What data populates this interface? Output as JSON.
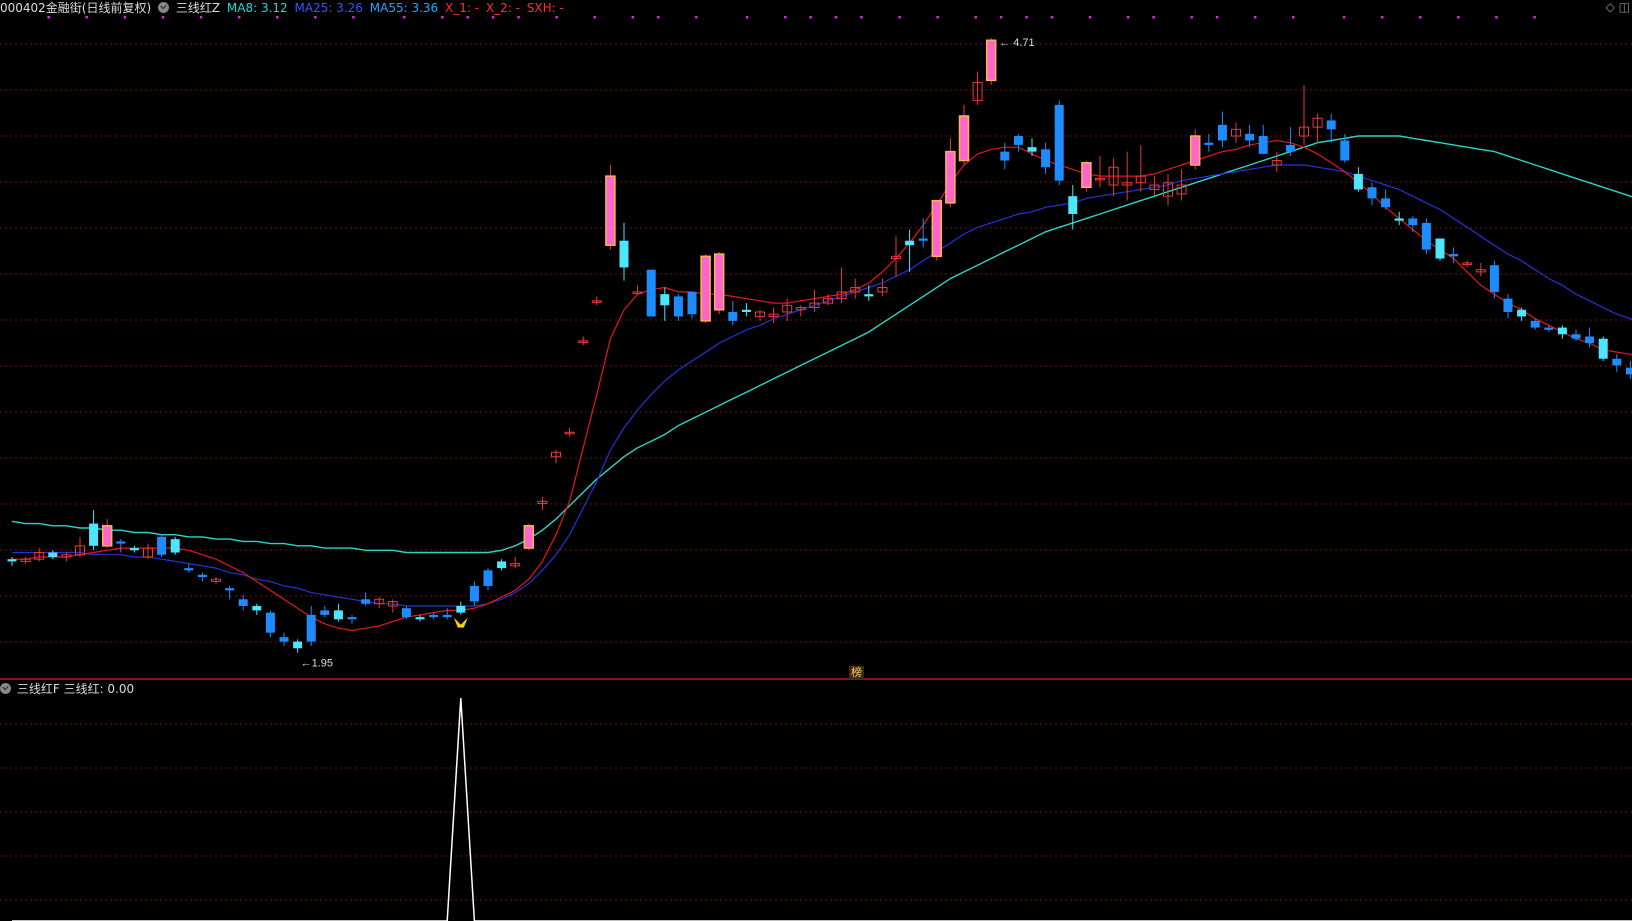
{
  "header": {
    "stock_title": "000402金融街(日线前复权)",
    "indicator_name": "三线红Z",
    "ma8": "MA8: 3.12",
    "ma25": "MA25: 3.26",
    "ma55": "MA55: 3.36",
    "x1": "X_1: -",
    "x2": "X_2: -",
    "sxh": "SXH: -"
  },
  "sub_header": {
    "indicator_name": "三线红F",
    "value": "三线红: 0.00"
  },
  "annotations": {
    "high_label": "4.71",
    "low_label": "1.95",
    "badge": "榜"
  },
  "colors": {
    "background": "#000000",
    "grid": "#7a1010",
    "divider": "#c01818",
    "up_candle": "#ff66cc",
    "up_candle_body_alt": "#ffb34d",
    "up_wick": "#e83a3a",
    "down_candle": "#4de6ff",
    "down_candle_alt": "#1e8cff",
    "ma8": "#29d6c6",
    "ma25": "#2433d6",
    "ma55": "#e01a1a",
    "signal_line": "#ffffff",
    "marker": "#cc33cc",
    "arrow": "#ffcc00",
    "stock_title": "#dddddd",
    "ma8_label": "#20d8d8",
    "ma25_label": "#3355ff",
    "ma55_label": "#20a8ff",
    "x_label": "#ff3030"
  },
  "icons": [
    "check-circle-icon",
    "diamond-icon",
    "window-restore-icon"
  ],
  "chart_data": [
    {
      "type": "candlestick",
      "series": [
        {
          "name": "MA8"
        },
        {
          "name": "MA25"
        },
        {
          "name": "MA55"
        }
      ],
      "ylim": [
        1.85,
        4.8
      ],
      "annotations": [
        "4.71",
        "1.95"
      ],
      "ohlc": [
        [
          2.37,
          2.38,
          2.34,
          2.36
        ],
        [
          2.36,
          2.38,
          2.35,
          2.37
        ],
        [
          2.37,
          2.42,
          2.36,
          2.4
        ],
        [
          2.4,
          2.41,
          2.37,
          2.38
        ],
        [
          2.38,
          2.4,
          2.36,
          2.39
        ],
        [
          2.39,
          2.47,
          2.38,
          2.43
        ],
        [
          2.53,
          2.59,
          2.41,
          2.43
        ],
        [
          2.43,
          2.55,
          2.42,
          2.52
        ],
        [
          2.45,
          2.46,
          2.4,
          2.44
        ],
        [
          2.42,
          2.43,
          2.4,
          2.41
        ],
        [
          2.38,
          2.44,
          2.37,
          2.42
        ],
        [
          2.47,
          2.48,
          2.38,
          2.39
        ],
        [
          2.46,
          2.47,
          2.39,
          2.4
        ],
        [
          2.33,
          2.35,
          2.31,
          2.32
        ],
        [
          2.3,
          2.31,
          2.27,
          2.29
        ],
        [
          2.27,
          2.29,
          2.26,
          2.28
        ],
        [
          2.24,
          2.25,
          2.19,
          2.23
        ],
        [
          2.19,
          2.21,
          2.14,
          2.16
        ],
        [
          2.16,
          2.17,
          2.12,
          2.14
        ],
        [
          2.13,
          2.14,
          2.02,
          2.04
        ],
        [
          2.02,
          2.04,
          1.98,
          2.0
        ],
        [
          2.0,
          2.01,
          1.95,
          1.97
        ],
        [
          2.12,
          2.16,
          1.98,
          2.0
        ],
        [
          2.14,
          2.16,
          2.11,
          2.12
        ],
        [
          2.14,
          2.17,
          2.09,
          2.1
        ],
        [
          2.11,
          2.12,
          2.08,
          2.1
        ],
        [
          2.19,
          2.22,
          2.16,
          2.17
        ],
        [
          2.17,
          2.2,
          2.15,
          2.19
        ],
        [
          2.16,
          2.19,
          2.13,
          2.18
        ],
        [
          2.15,
          2.16,
          2.1,
          2.11
        ],
        [
          2.11,
          2.12,
          2.09,
          2.1
        ],
        [
          2.12,
          2.13,
          2.1,
          2.11
        ],
        [
          2.12,
          2.15,
          2.1,
          2.11
        ],
        [
          2.16,
          2.18,
          2.12,
          2.13
        ],
        [
          2.25,
          2.27,
          2.16,
          2.18
        ],
        [
          2.32,
          2.33,
          2.23,
          2.25
        ],
        [
          2.36,
          2.37,
          2.32,
          2.33
        ],
        [
          2.34,
          2.38,
          2.33,
          2.35
        ],
        [
          2.42,
          2.53,
          2.41,
          2.52
        ],
        [
          2.62,
          2.65,
          2.59,
          2.63
        ],
        [
          2.83,
          2.86,
          2.8,
          2.85
        ],
        [
          2.94,
          2.96,
          2.92,
          2.94
        ],
        [
          3.35,
          3.37,
          3.33,
          3.35
        ],
        [
          3.53,
          3.55,
          3.51,
          3.53
        ],
        [
          3.78,
          4.14,
          3.76,
          4.09
        ],
        [
          3.8,
          3.88,
          3.62,
          3.68
        ],
        [
          3.57,
          3.6,
          3.57,
          3.57
        ],
        [
          3.67,
          3.6,
          3.46,
          3.46
        ],
        [
          3.56,
          3.59,
          3.44,
          3.51
        ],
        [
          3.55,
          3.56,
          3.44,
          3.46
        ],
        [
          3.57,
          3.55,
          3.45,
          3.47
        ],
        [
          3.44,
          3.74,
          3.43,
          3.73
        ],
        [
          3.49,
          3.75,
          3.47,
          3.74
        ],
        [
          3.48,
          3.53,
          3.42,
          3.44
        ],
        [
          3.49,
          3.52,
          3.46,
          3.48
        ],
        [
          3.46,
          3.49,
          3.44,
          3.48
        ],
        [
          3.46,
          3.5,
          3.43,
          3.47
        ],
        [
          3.48,
          3.54,
          3.44,
          3.51
        ],
        [
          3.49,
          3.51,
          3.46,
          3.5
        ],
        [
          3.5,
          3.58,
          3.48,
          3.52
        ],
        [
          3.52,
          3.56,
          3.51,
          3.54
        ],
        [
          3.54,
          3.68,
          3.52,
          3.57
        ],
        [
          3.57,
          3.63,
          3.54,
          3.59
        ],
        [
          3.56,
          3.6,
          3.53,
          3.55
        ],
        [
          3.57,
          3.63,
          3.55,
          3.59
        ],
        [
          3.72,
          3.82,
          3.64,
          3.73
        ],
        [
          3.8,
          3.85,
          3.66,
          3.78
        ],
        [
          3.81,
          3.9,
          3.77,
          3.8
        ],
        [
          3.73,
          3.98,
          3.71,
          3.98
        ],
        [
          3.97,
          4.26,
          3.95,
          4.2
        ],
        [
          4.16,
          4.41,
          4.14,
          4.36
        ],
        [
          4.43,
          4.56,
          4.41,
          4.51
        ],
        [
          4.52,
          4.71,
          4.5,
          4.7
        ],
        [
          4.2,
          4.24,
          4.12,
          4.16
        ],
        [
          4.27,
          4.28,
          4.2,
          4.23
        ],
        [
          4.22,
          4.26,
          4.18,
          4.2
        ],
        [
          4.21,
          4.24,
          4.1,
          4.13
        ],
        [
          4.41,
          4.43,
          4.05,
          4.07
        ],
        [
          4.0,
          4.05,
          3.85,
          3.92
        ],
        [
          4.04,
          4.16,
          4.02,
          4.15
        ],
        [
          4.08,
          4.18,
          4.04,
          4.08
        ],
        [
          4.05,
          4.17,
          4.0,
          4.13
        ],
        [
          4.05,
          4.2,
          3.98,
          4.06
        ],
        [
          4.06,
          4.23,
          4.02,
          4.09
        ],
        [
          4.03,
          4.09,
          4.0,
          4.05
        ],
        [
          4.0,
          4.1,
          3.96,
          4.06
        ],
        [
          4.01,
          4.12,
          3.98,
          4.05
        ],
        [
          4.14,
          4.3,
          4.12,
          4.27
        ],
        [
          4.24,
          4.28,
          4.2,
          4.23
        ],
        [
          4.32,
          4.38,
          4.22,
          4.25
        ],
        [
          4.27,
          4.33,
          4.24,
          4.3
        ],
        [
          4.28,
          4.32,
          4.22,
          4.25
        ],
        [
          4.27,
          4.32,
          4.19,
          4.19
        ],
        [
          4.14,
          4.2,
          4.11,
          4.16
        ],
        [
          4.23,
          4.31,
          4.18,
          4.2
        ],
        [
          4.27,
          4.5,
          4.23,
          4.31
        ],
        [
          4.31,
          4.37,
          4.24,
          4.35
        ],
        [
          4.34,
          4.37,
          4.24,
          4.3
        ],
        [
          4.25,
          4.28,
          4.15,
          4.16
        ],
        [
          4.1,
          4.13,
          4.02,
          4.03
        ],
        [
          4.04,
          4.06,
          3.96,
          3.99
        ],
        [
          3.99,
          4.03,
          3.94,
          3.95
        ],
        [
          3.9,
          3.93,
          3.87,
          3.89
        ],
        [
          3.9,
          3.91,
          3.84,
          3.87
        ],
        [
          3.88,
          3.9,
          3.74,
          3.76
        ],
        [
          3.81,
          3.81,
          3.71,
          3.72
        ],
        [
          3.74,
          3.77,
          3.7,
          3.73
        ],
        [
          3.7,
          3.71,
          3.68,
          3.7
        ],
        [
          3.66,
          3.7,
          3.64,
          3.67
        ],
        [
          3.69,
          3.71,
          3.54,
          3.57
        ],
        [
          3.54,
          3.56,
          3.45,
          3.48
        ],
        [
          3.49,
          3.5,
          3.44,
          3.46
        ],
        [
          3.44,
          3.45,
          3.4,
          3.41
        ],
        [
          3.41,
          3.42,
          3.39,
          3.4
        ],
        [
          3.41,
          3.42,
          3.36,
          3.38
        ],
        [
          3.38,
          3.4,
          3.35,
          3.36
        ],
        [
          3.37,
          3.41,
          3.32,
          3.34
        ],
        [
          3.36,
          3.37,
          3.26,
          3.27
        ],
        [
          3.27,
          3.29,
          3.21,
          3.24
        ],
        [
          3.23,
          3.26,
          3.18,
          3.2
        ],
        [
          3.31,
          3.35,
          3.22,
          3.25
        ],
        [
          3.3,
          3.33,
          3.25,
          3.28
        ],
        [
          3.32,
          3.35,
          3.28,
          3.3
        ],
        [
          3.35,
          3.38,
          3.3,
          3.33
        ],
        [
          3.34,
          3.36,
          3.28,
          3.33
        ],
        [
          3.33,
          3.35,
          3.3,
          3.31
        ],
        [
          3.32,
          3.34,
          3.3,
          3.32
        ],
        [
          3.27,
          3.29,
          3.22,
          3.24
        ],
        [
          3.22,
          3.24,
          3.2,
          3.21
        ]
      ],
      "ma8": [
        2.37,
        2.37,
        2.38,
        2.38,
        2.38,
        2.39,
        2.4,
        2.41,
        2.42,
        2.42,
        2.42,
        2.42,
        2.42,
        2.41,
        2.39,
        2.37,
        2.34,
        2.31,
        2.27,
        2.23,
        2.19,
        2.15,
        2.11,
        2.08,
        2.06,
        2.05,
        2.06,
        2.07,
        2.09,
        2.11,
        2.12,
        2.13,
        2.14,
        2.14,
        2.15,
        2.17,
        2.2,
        2.23,
        2.28,
        2.36,
        2.48,
        2.63,
        2.87,
        3.11,
        3.36,
        3.49,
        3.56,
        3.58,
        3.59,
        3.57,
        3.57,
        3.56,
        3.56,
        3.55,
        3.54,
        3.53,
        3.52,
        3.52,
        3.53,
        3.54,
        3.55,
        3.56,
        3.58,
        3.61,
        3.66,
        3.72,
        3.79,
        3.87,
        3.96,
        4.06,
        4.14,
        4.19,
        4.21,
        4.22,
        4.22,
        4.19,
        4.16,
        4.14,
        4.12,
        4.1,
        4.09,
        4.09,
        4.09,
        4.09,
        4.1,
        4.12,
        4.14,
        4.16,
        4.18,
        4.2,
        4.21,
        4.23,
        4.24,
        4.25,
        4.24,
        4.22,
        4.19,
        4.15,
        4.11,
        4.06,
        4.01,
        3.95,
        3.9,
        3.85,
        3.8,
        3.76,
        3.72,
        3.66,
        3.6,
        3.56,
        3.52,
        3.49,
        3.45,
        3.42,
        3.39,
        3.36,
        3.34,
        3.31,
        3.3,
        3.29,
        3.29,
        3.29,
        3.29,
        3.29,
        3.28,
        3.28,
        3.27
      ],
      "ma25": [
        2.4,
        2.4,
        2.4,
        2.4,
        2.4,
        2.4,
        2.39,
        2.39,
        2.39,
        2.38,
        2.38,
        2.37,
        2.36,
        2.35,
        2.34,
        2.33,
        2.31,
        2.3,
        2.28,
        2.27,
        2.25,
        2.24,
        2.22,
        2.21,
        2.2,
        2.19,
        2.18,
        2.17,
        2.17,
        2.16,
        2.16,
        2.16,
        2.16,
        2.16,
        2.16,
        2.17,
        2.19,
        2.22,
        2.26,
        2.32,
        2.39,
        2.48,
        2.6,
        2.72,
        2.86,
        2.96,
        3.04,
        3.11,
        3.17,
        3.22,
        3.26,
        3.3,
        3.34,
        3.37,
        3.4,
        3.42,
        3.45,
        3.47,
        3.49,
        3.51,
        3.53,
        3.55,
        3.57,
        3.59,
        3.61,
        3.64,
        3.67,
        3.71,
        3.75,
        3.79,
        3.83,
        3.86,
        3.88,
        3.9,
        3.92,
        3.93,
        3.95,
        3.96,
        3.97,
        3.99,
        4.0,
        4.01,
        4.02,
        4.03,
        4.04,
        4.05,
        4.07,
        4.08,
        4.09,
        4.1,
        4.11,
        4.12,
        4.13,
        4.14,
        4.14,
        4.14,
        4.13,
        4.12,
        4.11,
        4.09,
        4.07,
        4.05,
        4.03,
        4.0,
        3.97,
        3.94,
        3.9,
        3.86,
        3.82,
        3.78,
        3.74,
        3.71,
        3.67,
        3.63,
        3.6,
        3.56,
        3.53,
        3.5,
        3.47,
        3.45,
        3.43,
        3.41,
        3.39,
        3.37,
        3.35,
        3.33,
        3.31
      ],
      "ma55": [
        2.54,
        2.53,
        2.53,
        2.52,
        2.52,
        2.51,
        2.51,
        2.5,
        2.5,
        2.49,
        2.49,
        2.48,
        2.48,
        2.47,
        2.47,
        2.46,
        2.46,
        2.45,
        2.45,
        2.44,
        2.44,
        2.43,
        2.43,
        2.42,
        2.42,
        2.42,
        2.41,
        2.41,
        2.41,
        2.4,
        2.4,
        2.4,
        2.4,
        2.4,
        2.4,
        2.4,
        2.41,
        2.43,
        2.46,
        2.5,
        2.55,
        2.61,
        2.67,
        2.73,
        2.78,
        2.83,
        2.87,
        2.9,
        2.93,
        2.97,
        3.0,
        3.03,
        3.06,
        3.09,
        3.12,
        3.15,
        3.18,
        3.21,
        3.24,
        3.27,
        3.3,
        3.33,
        3.36,
        3.39,
        3.43,
        3.47,
        3.51,
        3.55,
        3.59,
        3.63,
        3.66,
        3.69,
        3.72,
        3.75,
        3.78,
        3.81,
        3.84,
        3.86,
        3.88,
        3.9,
        3.92,
        3.94,
        3.96,
        3.98,
        4.0,
        4.02,
        4.04,
        4.06,
        4.08,
        4.1,
        4.12,
        4.14,
        4.16,
        4.18,
        4.2,
        4.22,
        4.24,
        4.25,
        4.26,
        4.27,
        4.27,
        4.27,
        4.27,
        4.26,
        4.25,
        4.24,
        4.23,
        4.22,
        4.21,
        4.2,
        4.18,
        4.16,
        4.14,
        4.12,
        4.1,
        4.08,
        4.06,
        4.04,
        4.02,
        4.0,
        3.98,
        3.96,
        3.94,
        3.92,
        3.9,
        3.88,
        3.86
      ]
    },
    {
      "type": "line",
      "series": [
        {
          "name": "三线红"
        }
      ],
      "values_description_free": true,
      "values": [
        0,
        0,
        0,
        0,
        0,
        0,
        0,
        0,
        0,
        0,
        0,
        0,
        0,
        0,
        0,
        0,
        0,
        0,
        0,
        0,
        0,
        0,
        0,
        0,
        0,
        0,
        0,
        0,
        0,
        0,
        0,
        0,
        0,
        1,
        0,
        0,
        0,
        0,
        0,
        0,
        0,
        0,
        0,
        0,
        0,
        0,
        0,
        0,
        0,
        0,
        0,
        0,
        0,
        0,
        0,
        0,
        0,
        0,
        0,
        0,
        0,
        0,
        0,
        0,
        0,
        0,
        0,
        0,
        0,
        0,
        0,
        0,
        0,
        0,
        0,
        0,
        0,
        0,
        0,
        0,
        0,
        0,
        0,
        0,
        0,
        0,
        0,
        0,
        0,
        0,
        0,
        0,
        0,
        0,
        0,
        0,
        0,
        0,
        0,
        0,
        0,
        0,
        0,
        0,
        0,
        0,
        0,
        0,
        0,
        0,
        0,
        0,
        0,
        0,
        0,
        0,
        0,
        0,
        0,
        0,
        0,
        0,
        0,
        0,
        0,
        0,
        0
      ],
      "ylim": [
        0,
        1
      ]
    }
  ]
}
